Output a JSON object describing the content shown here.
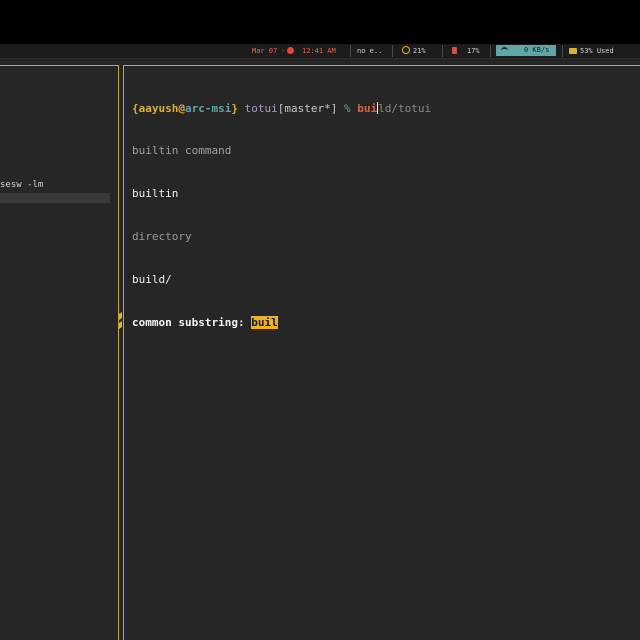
{
  "statusbar": {
    "date": "Mar 07",
    "time": "12:41 AM",
    "notification": "no e..",
    "cpu": "21%",
    "memory": "17%",
    "network": "0 KB/s",
    "disk": "53% Used",
    "icons": [
      "clock-icon",
      "cpu-icon",
      "memory-icon",
      "wifi-icon",
      "folder-icon"
    ],
    "colors": {
      "accent": "#e0b030",
      "network_bg": "#5fa6a6",
      "clock": "#e04a3a"
    }
  },
  "left_pane": {
    "text": "sesw -lm"
  },
  "terminal": {
    "prompt": {
      "open_brace": "{",
      "user": "aayush",
      "at": "@",
      "host": "arc-msi",
      "close_brace": "}",
      "dir": "totui",
      "branch": "[master*]",
      "symbol": "%",
      "typed": "bui",
      "autosuggest": "ld/totui"
    },
    "completions": [
      {
        "text": "builtin command"
      },
      {
        "text": "builtin"
      },
      {
        "text": "directory"
      },
      {
        "text": "build/"
      }
    ],
    "common_substring_label": "common substring:",
    "common_substring_value": "buil"
  }
}
